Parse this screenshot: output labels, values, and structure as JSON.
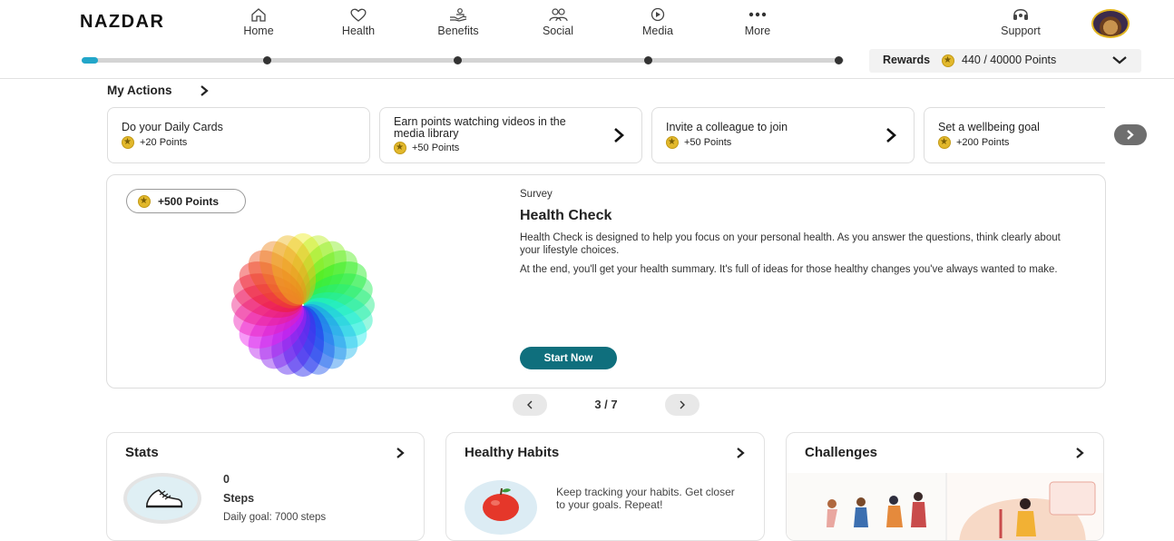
{
  "header": {
    "logo": "NAZDAR",
    "nav": [
      {
        "label": "Home",
        "icon": "home-icon"
      },
      {
        "label": "Health",
        "icon": "heart-icon"
      },
      {
        "label": "Benefits",
        "icon": "benefits-icon"
      },
      {
        "label": "Social",
        "icon": "people-icon"
      },
      {
        "label": "Media",
        "icon": "play-icon"
      },
      {
        "label": "More",
        "icon": "more-dots-icon"
      }
    ],
    "support": {
      "label": "Support",
      "icon": "headset-icon"
    },
    "progress": {
      "fraction": 0.02,
      "milestones": 5
    },
    "rewards": {
      "label": "Rewards",
      "points": "440 / 40000 Points"
    }
  },
  "actions": {
    "title": "My Actions",
    "cards": [
      {
        "title": "Do your Daily Cards",
        "points": "+20 Points"
      },
      {
        "title": "Earn points watching videos in the media library",
        "points": "+50 Points"
      },
      {
        "title": "Invite a colleague to join",
        "points": "+50 Points"
      },
      {
        "title": "Set a wellbeing goal",
        "points": "+200 Points"
      }
    ]
  },
  "feature": {
    "points": "+500 Points",
    "type": "Survey",
    "title": "Health Check",
    "desc1": "Health Check is designed to help you focus on your personal health. As you answer the questions, think clearly about your lifestyle choices.",
    "desc2": "At the end, you'll get your health summary. It's full of ideas for those healthy changes you've always wanted to make.",
    "button": "Start Now"
  },
  "pager": {
    "text": "3 / 7"
  },
  "panels": {
    "stats": {
      "title": "Stats",
      "value": "0",
      "unit": "Steps",
      "goal": "Daily goal: 7000 steps"
    },
    "habits": {
      "title": "Healthy Habits",
      "text": "Keep tracking your habits. Get closer to your goals. Repeat!"
    },
    "challenges": {
      "title": "Challenges"
    }
  },
  "colors": {
    "accent": "#22a6c9",
    "button": "#0f6f7d",
    "coin": "#e2b82c"
  }
}
